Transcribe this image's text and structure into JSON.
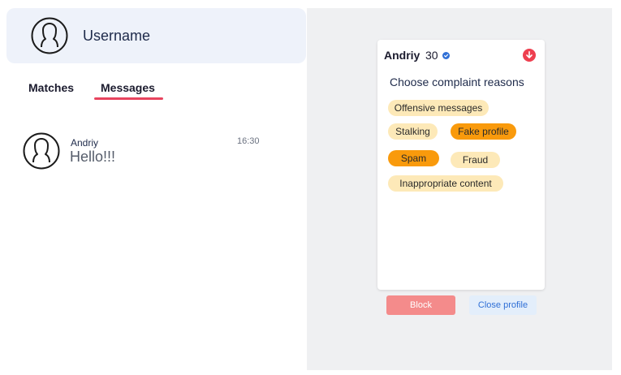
{
  "header": {
    "username": "Username"
  },
  "tabs": [
    {
      "label": "Matches"
    },
    {
      "label": "Messages"
    }
  ],
  "messages": [
    {
      "name": "Andriy",
      "text": "Hello!!!",
      "time": "16:30"
    }
  ],
  "profile": {
    "name": "Andriy",
    "age": "30",
    "complaint_title": "Choose complaint reasons",
    "reasons": [
      {
        "label": "Offensive messages",
        "selected": false
      },
      {
        "label": "Stalking",
        "selected": false
      },
      {
        "label": "Fake profile",
        "selected": true
      },
      {
        "label": "Spam",
        "selected": true
      },
      {
        "label": "Fraud",
        "selected": false
      },
      {
        "label": "Inappropriate content",
        "selected": false
      }
    ]
  },
  "actions": {
    "block_label": "Block",
    "close_label": "Close profile"
  },
  "colors": {
    "accent_red": "#e8445e",
    "chip_default": "#fde9b8",
    "chip_selected": "#f99a0c",
    "block_button": "#f48b8b",
    "close_button_text": "#2f6fd6",
    "verified": "#2f6fd6"
  },
  "icons": {
    "avatar": "user-avatar-icon",
    "verified": "verified-check-icon",
    "menu": "chevron-down-circle-icon"
  }
}
